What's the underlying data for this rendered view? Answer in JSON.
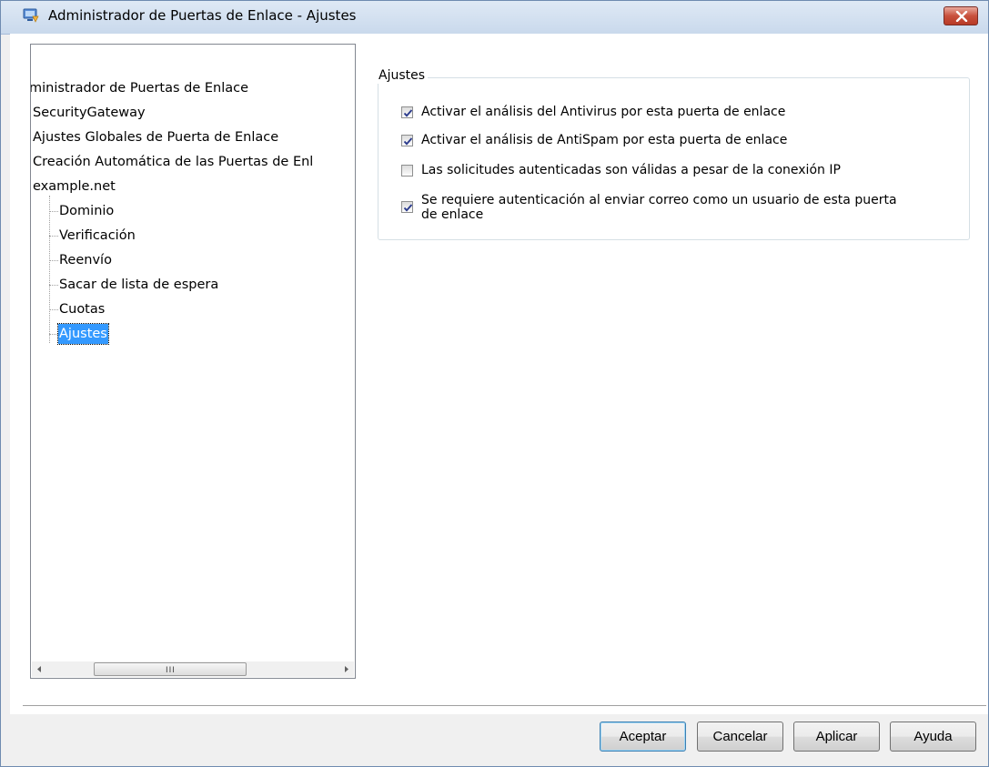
{
  "window": {
    "title": "Administrador de Puertas de Enlace - Ajustes"
  },
  "tree": {
    "items": [
      {
        "label": "ministrador de Puertas de Enlace",
        "level": 0
      },
      {
        "label": "SecurityGateway",
        "level": 0
      },
      {
        "label": "Ajustes Globales de Puerta de Enlace",
        "level": 0
      },
      {
        "label": "Creación Automática de las Puertas de Enl",
        "level": 0
      },
      {
        "label": "example.net",
        "level": 0
      },
      {
        "label": "Dominio",
        "level": 1
      },
      {
        "label": "Verificación",
        "level": 1
      },
      {
        "label": "Reenvío",
        "level": 1
      },
      {
        "label": "Sacar de lista de espera",
        "level": 1
      },
      {
        "label": "Cuotas",
        "level": 1
      },
      {
        "label": "Ajustes",
        "level": 1,
        "selected": true
      }
    ],
    "scroll_grip": "III"
  },
  "settings": {
    "group_title": "Ajustes",
    "options": [
      {
        "label": "Activar el análisis del Antivirus por esta puerta de enlace",
        "checked": true
      },
      {
        "label": "Activar el análisis de AntiSpam por esta puerta de enlace",
        "checked": true
      },
      {
        "label": "Las solicitudes autenticadas son válidas a pesar de la conexión IP",
        "checked": false
      },
      {
        "label_line1": "Se requiere autenticación al enviar correo como un usuario de esta puerta",
        "label_line2": "de enlace",
        "checked": true
      }
    ]
  },
  "buttons": {
    "ok": "Aceptar",
    "cancel": "Cancelar",
    "apply": "Aplicar",
    "help": "Ayuda"
  }
}
